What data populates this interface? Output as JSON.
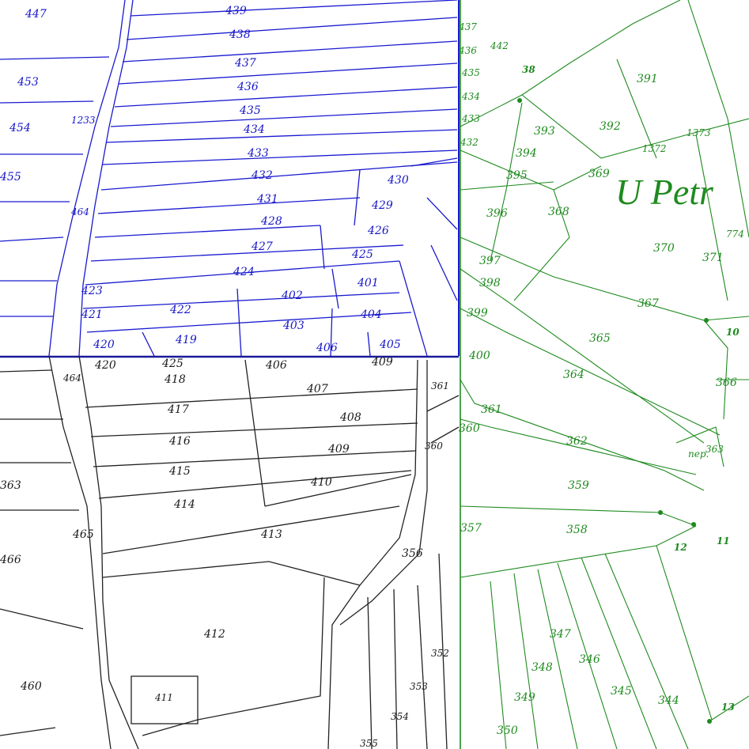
{
  "place_name": "U Petr",
  "colors": {
    "blue": "#1616c8",
    "green": "#1f8a1f",
    "black": "#1a1a1a"
  },
  "blue_parcels": [
    "447",
    "439",
    "438",
    "437",
    "436",
    "435",
    "434",
    "433",
    "432",
    "431",
    "430",
    "429",
    "428",
    "427",
    "426",
    "425",
    "424",
    "423",
    "422",
    "421",
    "420",
    "419",
    "402",
    "401",
    "403",
    "404",
    "405",
    "406",
    "453",
    "454",
    "455",
    "1233",
    "464"
  ],
  "black_parcels": [
    "420",
    "425",
    "418",
    "407",
    "417",
    "408",
    "416",
    "409",
    "415",
    "410",
    "414",
    "413",
    "412",
    "411",
    "406",
    "409",
    "361",
    "360",
    "356",
    "355",
    "354",
    "353",
    "352",
    "466",
    "465",
    "464",
    "460",
    "363"
  ],
  "green_parcels": [
    "437",
    "436",
    "442",
    "435",
    "434",
    "433",
    "432",
    "391",
    "393",
    "392",
    "394",
    "395",
    "396",
    "368",
    "369",
    "1372",
    "1373",
    "397",
    "398",
    "399",
    "370",
    "371",
    "367",
    "365",
    "364",
    "366",
    "400",
    "361",
    "360",
    "362",
    "363",
    "359",
    "358",
    "357",
    "347",
    "348",
    "346",
    "349",
    "345",
    "344",
    "350",
    "774"
  ],
  "point_numbers": [
    "38",
    "10",
    "12",
    "11",
    "13"
  ],
  "misc_labels": [
    "nep."
  ]
}
